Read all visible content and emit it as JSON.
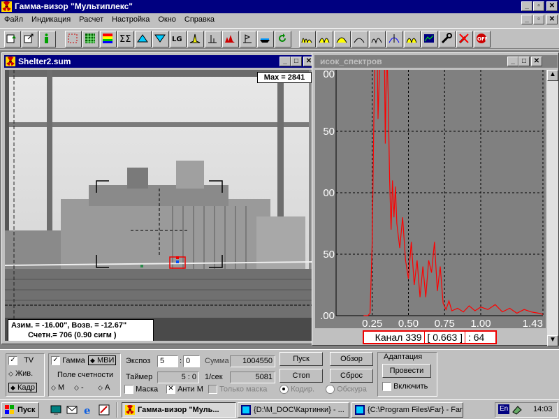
{
  "app": {
    "title": "Гамма-визор \"Мультиплекс\"",
    "menu": [
      "Файл",
      "Индикация",
      "Расчет",
      "Настройка",
      "Окно",
      "Справка"
    ]
  },
  "image_window": {
    "title": "Shelter2.sum",
    "max_label": "Max = 2841",
    "coords_line": "Азим. = -16.00\", Возв. = -12.67\"",
    "counts_line": "Счетн.= 706 (0.90 сигм )"
  },
  "spectrum_window": {
    "title": "исок_спектров",
    "readout": {
      "channel": "Канал 339",
      "value": "0.663",
      "count": ": 64"
    }
  },
  "chart_data": {
    "type": "line",
    "xlabel": "",
    "ylabel": "",
    "x_ticks": [
      "0.25",
      "0.50",
      "0.75",
      "1.00",
      "1.43"
    ],
    "y_ticks": [
      "00",
      "50",
      "00",
      "50",
      ".00"
    ],
    "xlim": [
      0.0,
      1.43
    ],
    "ylim": [
      0,
      200
    ],
    "grid": true,
    "color": "#ff0000",
    "series": [
      {
        "x": [
          0.19,
          0.22,
          0.235,
          0.25,
          0.26,
          0.27,
          0.28,
          0.29,
          0.3,
          0.31,
          0.32,
          0.33,
          0.34,
          0.35,
          0.36,
          0.37,
          0.38,
          0.39,
          0.4,
          0.41,
          0.42,
          0.44,
          0.46,
          0.48,
          0.5,
          0.52,
          0.54,
          0.56,
          0.58,
          0.6,
          0.62,
          0.64,
          0.66,
          0.68,
          0.7,
          0.72,
          0.74,
          0.76,
          0.78,
          0.8,
          0.84,
          0.88,
          0.92,
          0.96,
          1.0,
          1.05,
          1.1,
          1.15,
          1.2,
          1.25,
          1.3,
          1.35,
          1.4,
          1.43
        ],
        "y": [
          0,
          0,
          2,
          60,
          150,
          230,
          250,
          160,
          200,
          250,
          200,
          260,
          140,
          220,
          180,
          110,
          70,
          110,
          80,
          105,
          75,
          55,
          80,
          45,
          30,
          60,
          25,
          45,
          15,
          40,
          15,
          45,
          35,
          60,
          20,
          40,
          10,
          5,
          12,
          4,
          6,
          3,
          8,
          4,
          7,
          5,
          9,
          3,
          6,
          2,
          5,
          3,
          2,
          1
        ]
      }
    ]
  },
  "controls": {
    "tv_label": "TV",
    "live_label": "Жив.",
    "frame_label": "Кадр",
    "gamma_label": "Гамма",
    "mvi_label": "МВИ",
    "count_field_label": "Поле счетности",
    "m_label": "М",
    "minus_label": "-",
    "a_label": "А",
    "exposure_label": "Экспоз",
    "exposure_min": "5",
    "exposure_sec": "0",
    "timer_label": "Таймер",
    "timer_value": "5 : 0",
    "sum_label": "Сумма",
    "sum_value": "1004550",
    "rate_label": "1/сек",
    "rate_value": "5081",
    "mask_label": "Маска",
    "antimask_label": "Анти М",
    "only_mask_label": "Только маска",
    "start_label": "Пуск",
    "stop_label": "Стоп",
    "overview_label": "Обзор",
    "reset_label": "Сброс",
    "coding_label": "Кодир.",
    "obscura_label": "Обскура",
    "adaptation_label": "Адаптация",
    "perform_label": "Провести",
    "enable_label": "Включить"
  },
  "taskbar": {
    "start_label": "Пуск",
    "tasks": [
      "Гамма-визор \"Муль...",
      "{D:\\M_DOC\\Картинки} - ...",
      "{C:\\Program Files\\Far} - Far"
    ],
    "lang": "En",
    "clock": "14:03"
  }
}
